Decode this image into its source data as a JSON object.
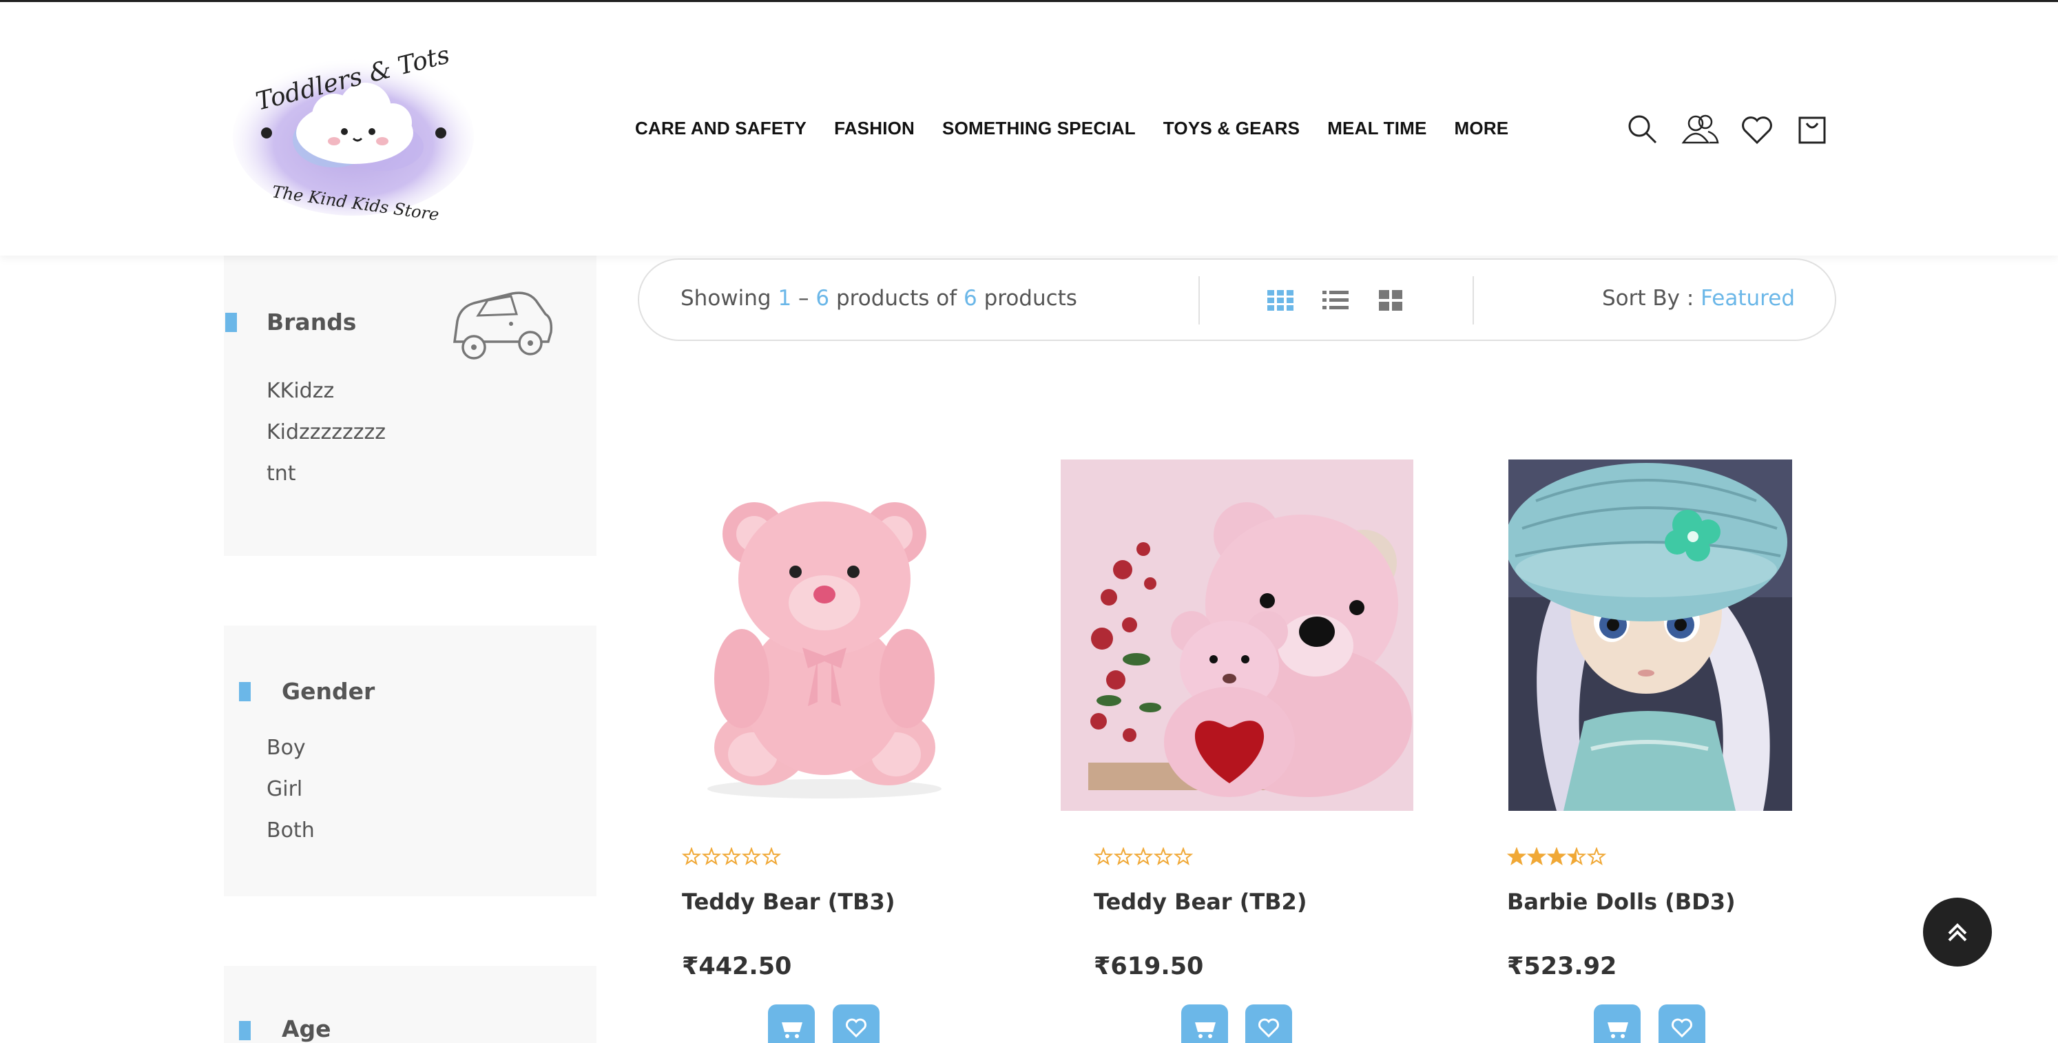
{
  "logo": {
    "top_text": "Toddlers & Tots",
    "bottom_text": "The Kind Kids Store"
  },
  "nav": {
    "items": [
      "CARE AND SAFETY",
      "FASHION",
      "SOMETHING SPECIAL",
      "TOYS & GEARS",
      "MEAL TIME",
      "MORE"
    ]
  },
  "header_icons": [
    "search-icon",
    "account-icon",
    "wishlist-icon",
    "cart-icon"
  ],
  "sidebar": {
    "brands": {
      "title": "Brands",
      "items": [
        "KKidzz",
        "Kidzzzzzzzz",
        "tnt"
      ]
    },
    "gender": {
      "title": "Gender",
      "items": [
        "Boy",
        "Girl",
        "Both"
      ]
    },
    "age": {
      "title": "Age"
    }
  },
  "toolbar": {
    "showing_prefix": "Showing",
    "from": "1",
    "dash": "–",
    "to": "6",
    "mid": "products of",
    "total": "6",
    "suffix": "products",
    "sort_label": "Sort By :",
    "sort_value": "Featured"
  },
  "products": [
    {
      "name": "Teddy Bear (TB3)",
      "price": "₹442.50",
      "rating": 0
    },
    {
      "name": "Teddy Bear (TB2)",
      "price": "₹619.50",
      "rating": 0
    },
    {
      "name": "Barbie Dolls (BD3)",
      "price": "₹523.92",
      "rating": 3.5
    }
  ],
  "colors": {
    "accent": "#6bb7e8",
    "star": "#f0a836",
    "dark": "#222222"
  }
}
